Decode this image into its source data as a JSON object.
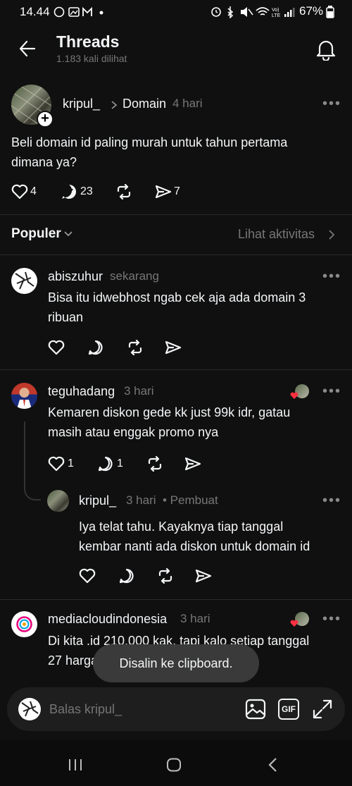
{
  "status": {
    "time": "14.44",
    "battery": "67%"
  },
  "header": {
    "title": "Threads",
    "subtitle": "1.183 kali dilihat"
  },
  "post": {
    "author": "kripul_",
    "topic": "Domain",
    "time": "4 hari",
    "text_line1": "Beli domain id paling murah untuk tahun pertama",
    "text_line2": "dimana ya?",
    "likes": "4",
    "replies": "23",
    "shares": "7"
  },
  "filter": {
    "label": "Populer",
    "activity": "Lihat aktivitas"
  },
  "comments": [
    {
      "author": "abiszuhur",
      "time": "sekarang",
      "line1": "Bisa itu idwebhost ngab cek aja ada domain 3",
      "line2": "ribuan"
    },
    {
      "author": "teguhadang",
      "time": "3 hari",
      "line1": "Kemaren diskon gede kk just 99k idr, gatau",
      "line2": "masih atau enggak promo nya",
      "likes": "1",
      "replies": "1"
    },
    {
      "author": "kripul_",
      "time": "3 hari",
      "badge": "• Pembuat",
      "line1": "Iya telat tahu. Kayaknya tiap tanggal",
      "line2": "kembar nanti ada diskon untuk domain id"
    },
    {
      "author": "mediacloudindonesia",
      "time": "3 hari",
      "line1": "Di kita .id 210.000 kak, tapi kalo setiap tanggal",
      "line2": "27 hargan"
    }
  ],
  "toast": "Disalin ke clipboard.",
  "reply": {
    "placeholder": "Balas kripul_",
    "gif": "GIF"
  }
}
